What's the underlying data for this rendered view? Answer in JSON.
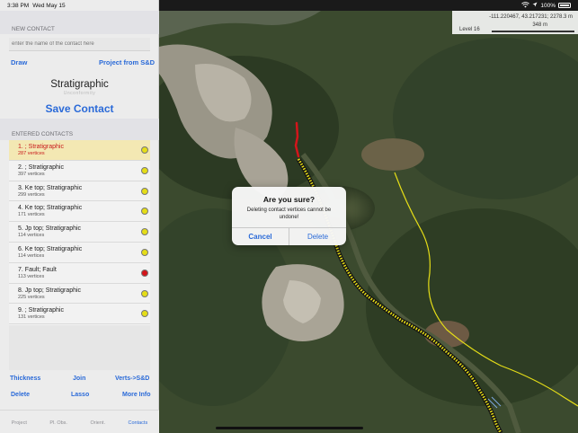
{
  "status": {
    "time": "3:38 PM",
    "date": "Wed May 15",
    "battery": "100%"
  },
  "sidebar": {
    "new_contact_header": "NEW CONTACT",
    "contact_name_placeholder": "enter the name of the contact here",
    "draw_label": "Draw",
    "project_label": "Project from S&D",
    "contact_type_selected": "Stratigraphic",
    "contact_type_below": "Unconformity",
    "save_label": "Save Contact",
    "entered_header": "ENTERED CONTACTS",
    "contacts": [
      {
        "index": "1.",
        "name": ";  Stratigraphic",
        "vertices": "287 vertices",
        "dot_color": "#e5dd17",
        "selected": true
      },
      {
        "index": "2.",
        "name": ";  Stratigraphic",
        "vertices": "397 vertices",
        "dot_color": "#e5dd17",
        "selected": false
      },
      {
        "index": "3.",
        "name": "Ke top;  Stratigraphic",
        "vertices": "299 vertices",
        "dot_color": "#e5dd17",
        "selected": false
      },
      {
        "index": "4.",
        "name": "Ke top;  Stratigraphic",
        "vertices": "171 vertices",
        "dot_color": "#e5dd17",
        "selected": false
      },
      {
        "index": "5.",
        "name": "Jp top;  Stratigraphic",
        "vertices": "114 vertices",
        "dot_color": "#e5dd17",
        "selected": false
      },
      {
        "index": "6.",
        "name": "Ke top;  Stratigraphic",
        "vertices": "114 vertices",
        "dot_color": "#e5dd17",
        "selected": false
      },
      {
        "index": "7.",
        "name": "Fault;  Fault",
        "vertices": "113 vertices",
        "dot_color": "#d4151b",
        "selected": false
      },
      {
        "index": "8.",
        "name": "Jp top;  Stratigraphic",
        "vertices": "225 vertices",
        "dot_color": "#e5dd17",
        "selected": false
      },
      {
        "index": "9.",
        "name": ";  Stratigraphic",
        "vertices": "131 vertices",
        "dot_color": "#e5dd17",
        "selected": false
      }
    ],
    "actions": {
      "thickness": "Thickness",
      "join": "Join",
      "verts_to_sd": "Verts->S&D",
      "delete": "Delete",
      "lasso": "Lasso",
      "more_info": "More Info"
    },
    "tabs": [
      {
        "label": "Project",
        "active": false
      },
      {
        "label": "Pl. Obs.",
        "active": false
      },
      {
        "label": "Orient.",
        "active": false
      },
      {
        "label": "Contacts",
        "active": true
      }
    ]
  },
  "map": {
    "coordinates": "-111.220467, 43.217231;   2278.3 m",
    "level": "Level 16",
    "scale_label": "348 m"
  },
  "dialog": {
    "title": "Are you sure?",
    "message": "Deleting contact vertices cannot be undone!",
    "cancel_label": "Cancel",
    "delete_label": "Delete"
  },
  "colors": {
    "accent": "#2a6ad8",
    "selected_row": "#f3e8b3",
    "selected_text": "#c8191b",
    "contact_yellow": "#e5dd17",
    "fault_red": "#d4151b"
  }
}
